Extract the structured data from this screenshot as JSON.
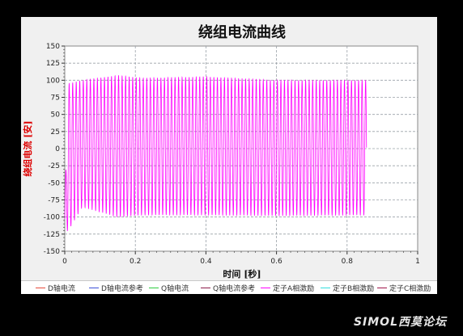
{
  "chart_data": {
    "type": "line",
    "title": "绕组电流曲线",
    "xlabel": "时间 [秒]",
    "ylabel": "绕组电流 [安]",
    "xlim": [
      0,
      1
    ],
    "ylim": [
      -150,
      150
    ],
    "x_ticks": [
      "0",
      "0.2",
      "0.4",
      "0.6",
      "0.8",
      "1"
    ],
    "y_ticks": [
      "150",
      "125",
      "100",
      "75",
      "50",
      "25",
      "0",
      "-25",
      "-50",
      "-75",
      "-100",
      "-125",
      "-150"
    ],
    "grid": true,
    "legend_position": "bottom",
    "series": [
      {
        "name": "D轴电流",
        "color": "#e74c3c",
        "values": []
      },
      {
        "name": "D轴电流参考",
        "color": "#3b4fd8",
        "values": []
      },
      {
        "name": "Q轴电流",
        "color": "#2ecc40",
        "values": []
      },
      {
        "name": "Q轴电流参考",
        "color": "#8b1a4a",
        "values": []
      },
      {
        "name": "定子A相激励",
        "color": "#ff00ff",
        "frequency_hz": 100,
        "x_end": 0.855,
        "envelope": [
          {
            "x": 0.0,
            "upper": -85,
            "lower": -120
          },
          {
            "x": 0.01,
            "upper": 95,
            "lower": -120
          },
          {
            "x": 0.05,
            "upper": 100,
            "lower": -85
          },
          {
            "x": 0.15,
            "upper": 107,
            "lower": -100
          },
          {
            "x": 0.22,
            "upper": 103,
            "lower": -97
          },
          {
            "x": 0.4,
            "upper": 105,
            "lower": -97
          },
          {
            "x": 0.6,
            "upper": 100,
            "lower": -98
          },
          {
            "x": 0.855,
            "upper": 100,
            "lower": -97
          }
        ]
      },
      {
        "name": "定子B相激励",
        "color": "#33dddd",
        "values": []
      },
      {
        "name": "定子C相激励",
        "color": "#a0144a",
        "values": []
      }
    ]
  },
  "watermark": "SIMOL西莫论坛",
  "colors": {
    "title": "#111111",
    "ylabel": "#dd0000",
    "plot_bg": "#ffffff",
    "frame_bg": "#f0f0f0"
  }
}
